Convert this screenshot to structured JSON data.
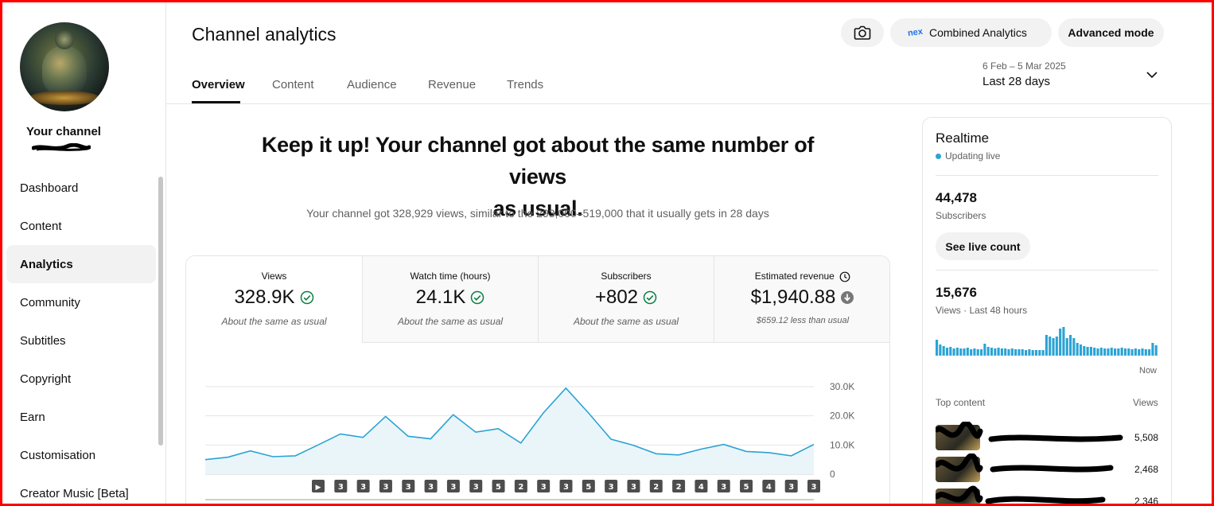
{
  "sidebar": {
    "channel_label": "Your channel",
    "items": [
      {
        "label": "Dashboard",
        "active": false
      },
      {
        "label": "Content",
        "active": false
      },
      {
        "label": "Analytics",
        "active": true
      },
      {
        "label": "Community",
        "active": false
      },
      {
        "label": "Subtitles",
        "active": false
      },
      {
        "label": "Copyright",
        "active": false
      },
      {
        "label": "Earn",
        "active": false
      },
      {
        "label": "Customisation",
        "active": false
      },
      {
        "label": "Creator Music [Beta]",
        "active": false
      }
    ]
  },
  "header": {
    "title": "Channel analytics",
    "combined_label": "Combined Analytics",
    "combined_logo_text": "nex",
    "advanced_label": "Advanced mode",
    "date_range": "6 Feb – 5 Mar 2025",
    "date_label": "Last 28 days"
  },
  "tabs": [
    {
      "label": "Overview",
      "active": true
    },
    {
      "label": "Content",
      "active": false
    },
    {
      "label": "Audience",
      "active": false
    },
    {
      "label": "Revenue",
      "active": false
    },
    {
      "label": "Trends",
      "active": false
    }
  ],
  "summary": {
    "headline_line1": "Keep it up! Your channel got about the same number of views",
    "headline_line2": "as usual.",
    "subline": "Your channel got 328,929 views, similar to the 293,000–519,000 that it usually gets in 28 days"
  },
  "metrics": [
    {
      "label": "Views",
      "value": "328.9K",
      "note": "About the same as usual",
      "status": "check"
    },
    {
      "label": "Watch time (hours)",
      "value": "24.1K",
      "note": "About the same as usual",
      "status": "check"
    },
    {
      "label": "Subscribers",
      "value": "+802",
      "note": "About the same as usual",
      "status": "check"
    },
    {
      "label": "Estimated revenue",
      "value": "$1,940.88",
      "note": "$659.12 less than usual",
      "status": "down",
      "has_clock": true
    }
  ],
  "chart_data": {
    "type": "area",
    "series": [
      {
        "values": [
          5000,
          5800,
          8000,
          6000,
          6300,
          10000,
          13800,
          12600,
          19800,
          13000,
          12100,
          20400,
          14400,
          15600,
          10700,
          21000,
          29500,
          21000,
          12000,
          9900,
          7000,
          6600,
          8600,
          10200,
          7800,
          7400,
          6300,
          10200
        ]
      }
    ],
    "ylim": [
      0,
      30000
    ],
    "yticks": [
      "30.0K",
      "20.0K",
      "10.0K",
      "0"
    ],
    "grid": true,
    "upload_markers": [
      "▶",
      "3",
      "3",
      "3",
      "3",
      "3",
      "3",
      "3",
      "5",
      "2",
      "3",
      "3",
      "5",
      "3",
      "3",
      "2",
      "2",
      "4",
      "3",
      "5",
      "4",
      "3",
      "3"
    ],
    "colors": {
      "line": "#2ba3d4",
      "fill": "#eaf5fa",
      "grid": "#e5e5e5",
      "marker": "#4d4d4d"
    }
  },
  "realtime": {
    "title": "Realtime",
    "live_label": "Updating live",
    "subscribers": "44,478",
    "subscribers_label": "Subscribers",
    "see_live_label": "See live count",
    "views": "15,676",
    "views_label": "Views · Last 48 hours",
    "bars": [
      20,
      14,
      12,
      10,
      11,
      9,
      10,
      9,
      9,
      10,
      8,
      9,
      8,
      8,
      15,
      11,
      10,
      9,
      10,
      9,
      9,
      8,
      9,
      8,
      8,
      8,
      7,
      8,
      7,
      7,
      7,
      7,
      26,
      24,
      22,
      24,
      34,
      36,
      22,
      26,
      22,
      16,
      14,
      12,
      11,
      11,
      10,
      9,
      10,
      9,
      9,
      10,
      9,
      9,
      10,
      9,
      9,
      8,
      9,
      8,
      9,
      8,
      8,
      16,
      13
    ],
    "now_label": "Now",
    "top_content_label": "Top content",
    "views_col_label": "Views",
    "top_content": [
      {
        "views": "5,508"
      },
      {
        "views": "2,468"
      },
      {
        "views": "2,346"
      }
    ],
    "accent": "#2ba3d4"
  }
}
